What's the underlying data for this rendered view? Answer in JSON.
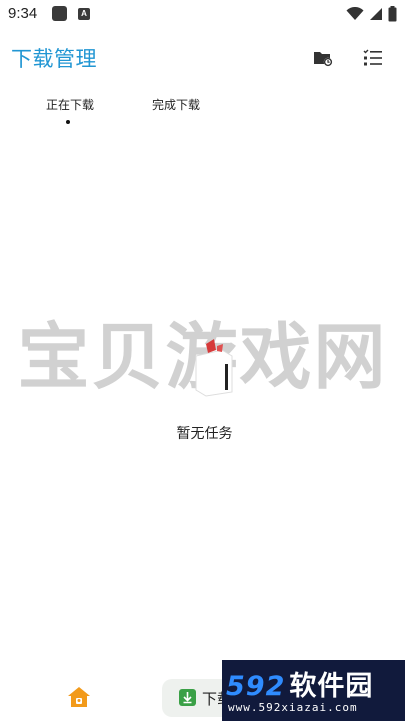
{
  "status_bar": {
    "time": "9:34",
    "icons": [
      "app-notification-icon",
      "a-badge-icon",
      "wifi-icon",
      "signal-icon",
      "battery-icon"
    ],
    "a_badge": "A"
  },
  "app_bar": {
    "title": "下载管理",
    "actions": [
      "folder-settings-icon",
      "checklist-icon"
    ],
    "accent_color": "#2196d3"
  },
  "tabs": [
    {
      "label": "正在下载",
      "selected": true
    },
    {
      "label": "完成下载",
      "selected": false
    }
  ],
  "empty_state": {
    "message": "暂无任务"
  },
  "watermark": {
    "text": "宝贝游戏网"
  },
  "bottom_nav": {
    "home_icon": "home-icon",
    "download_label": "下载"
  },
  "corner_logo": {
    "brand": "592",
    "brand_cn": "软件园",
    "url": "www.592xiazai.com"
  }
}
